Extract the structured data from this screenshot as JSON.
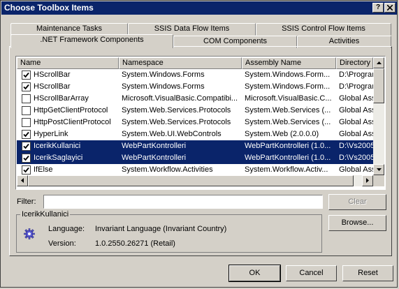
{
  "window": {
    "title": "Choose Toolbox Items",
    "help_label": "?",
    "close_label": "X"
  },
  "tabs": {
    "back_row": [
      "Maintenance Tasks",
      "SSIS Data Flow Items",
      "SSIS Control Flow Items"
    ],
    "front_row": [
      ".NET Framework Components",
      "COM Components",
      "Activities"
    ],
    "selected": ".NET Framework Components"
  },
  "grid": {
    "columns": [
      "Name",
      "Namespace",
      "Assembly Name",
      "Directory"
    ],
    "rows": [
      {
        "checked": true,
        "selected": false,
        "name": "HScrollBar",
        "namespace": "System.Windows.Forms",
        "assembly": "System.Windows.Form...",
        "directory": "D:\\Prograı"
      },
      {
        "checked": true,
        "selected": false,
        "name": "HScrollBar",
        "namespace": "System.Windows.Forms",
        "assembly": "System.Windows.Form...",
        "directory": "D:\\Prograı"
      },
      {
        "checked": false,
        "selected": false,
        "name": "HScrollBarArray",
        "namespace": "Microsoft.VisualBasic.Compatibi...",
        "assembly": "Microsoft.VisualBasic.C...",
        "directory": "Global Ass"
      },
      {
        "checked": false,
        "selected": false,
        "name": "HttpGetClientProtocol",
        "namespace": "System.Web.Services.Protocols",
        "assembly": "System.Web.Services (...",
        "directory": "Global Ass"
      },
      {
        "checked": false,
        "selected": false,
        "name": "HttpPostClientProtocol",
        "namespace": "System.Web.Services.Protocols",
        "assembly": "System.Web.Services (...",
        "directory": "Global Ass"
      },
      {
        "checked": true,
        "selected": false,
        "name": "HyperLink",
        "namespace": "System.Web.UI.WebControls",
        "assembly": "System.Web (2.0.0.0)",
        "directory": "Global Ass"
      },
      {
        "checked": true,
        "selected": true,
        "name": "IcerikKullanici",
        "namespace": "WebPartKontrolleri",
        "assembly": "WebPartKontrolleri (1.0...",
        "directory": "D:\\Vs2005"
      },
      {
        "checked": true,
        "selected": true,
        "name": "IcerikSaglayici",
        "namespace": "WebPartKontrolleri",
        "assembly": "WebPartKontrolleri (1.0...",
        "directory": "D:\\Vs2005"
      },
      {
        "checked": true,
        "selected": false,
        "name": "IfElse",
        "namespace": "System.Workflow.Activities",
        "assembly": "System.Workflow.Activ...",
        "directory": "Global Ass"
      }
    ]
  },
  "filter": {
    "label": "Filter:",
    "value": "",
    "clear_label": "Clear"
  },
  "details": {
    "group_title": "IcerikKullanici",
    "language_label": "Language:",
    "language_value": "Invariant Language (Invariant Country)",
    "version_label": "Version:",
    "version_value": "1.0.2550.26271 (Retail)",
    "icon": "gear-icon"
  },
  "buttons": {
    "browse": "Browse...",
    "ok": "OK",
    "cancel": "Cancel",
    "reset": "Reset"
  },
  "colors": {
    "title_bar": "#0a246a",
    "selection": "#0a246a",
    "face": "#d4d0c8"
  }
}
